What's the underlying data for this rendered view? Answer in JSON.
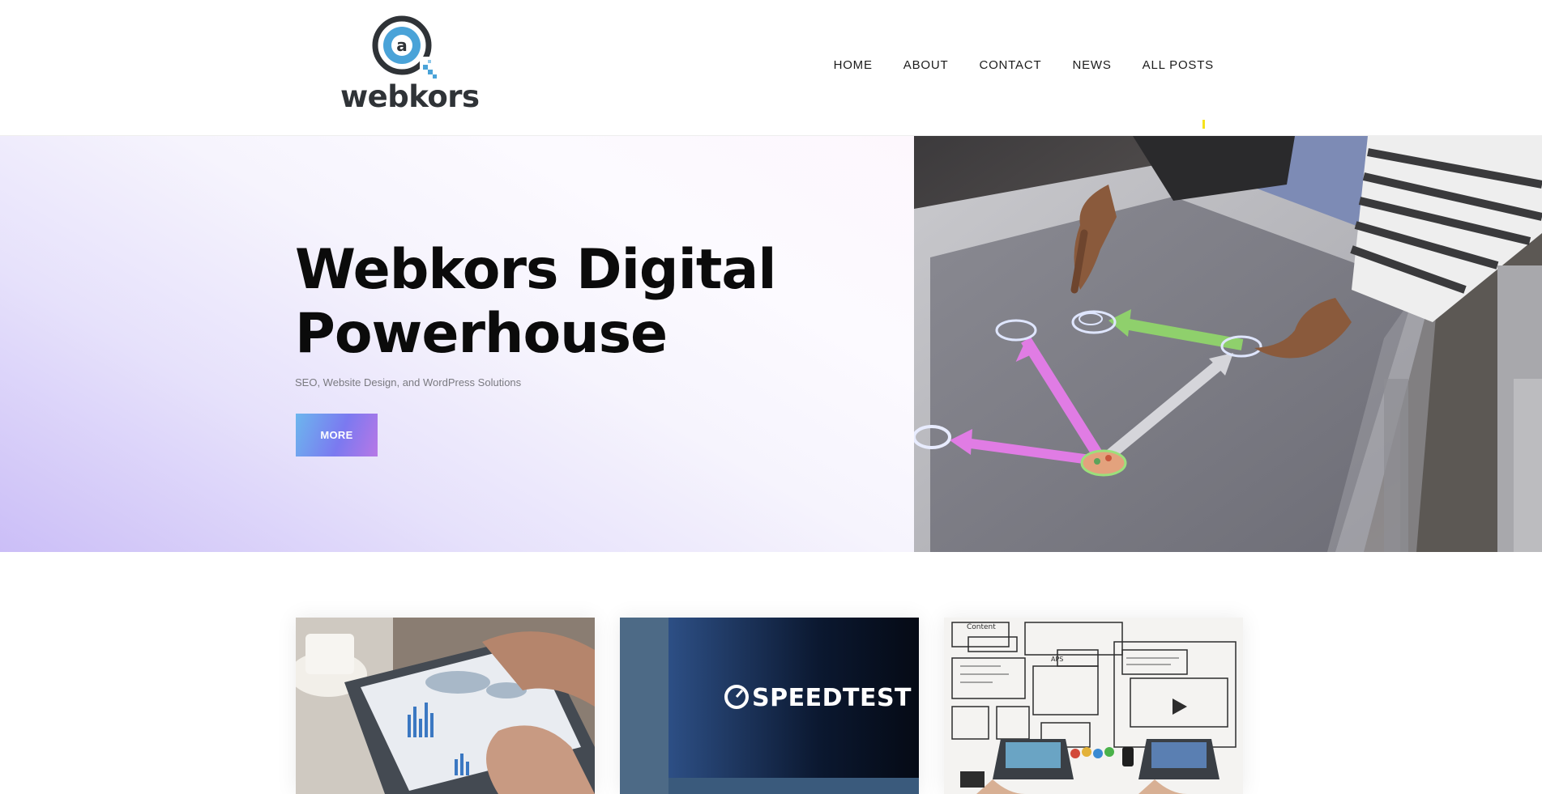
{
  "site": {
    "logo_text": "webkors"
  },
  "nav": {
    "items": [
      {
        "label": "HOME"
      },
      {
        "label": "ABOUT"
      },
      {
        "label": "CONTACT"
      },
      {
        "label": "NEWS"
      },
      {
        "label": "ALL POSTS"
      }
    ]
  },
  "hero": {
    "title_line1": "Webkors Digital",
    "title_line2": "Powerhouse",
    "subtitle": "SEO, Website Design, and WordPress Solutions",
    "button_label": "MORE"
  },
  "cards": {
    "items": [
      {
        "image": "tablet-analytics-photo"
      },
      {
        "image": "speedtest-screen-photo",
        "overlay_text": "SPEEDTEST"
      },
      {
        "image": "web-design-sketch-photo"
      }
    ]
  },
  "colors": {
    "nav_accent": "#f6e21b",
    "button_gradient_start": "#6cb6ee",
    "button_gradient_end": "#b778e6",
    "logo_blue": "#4aa3d8",
    "logo_dark": "#2f3337"
  }
}
